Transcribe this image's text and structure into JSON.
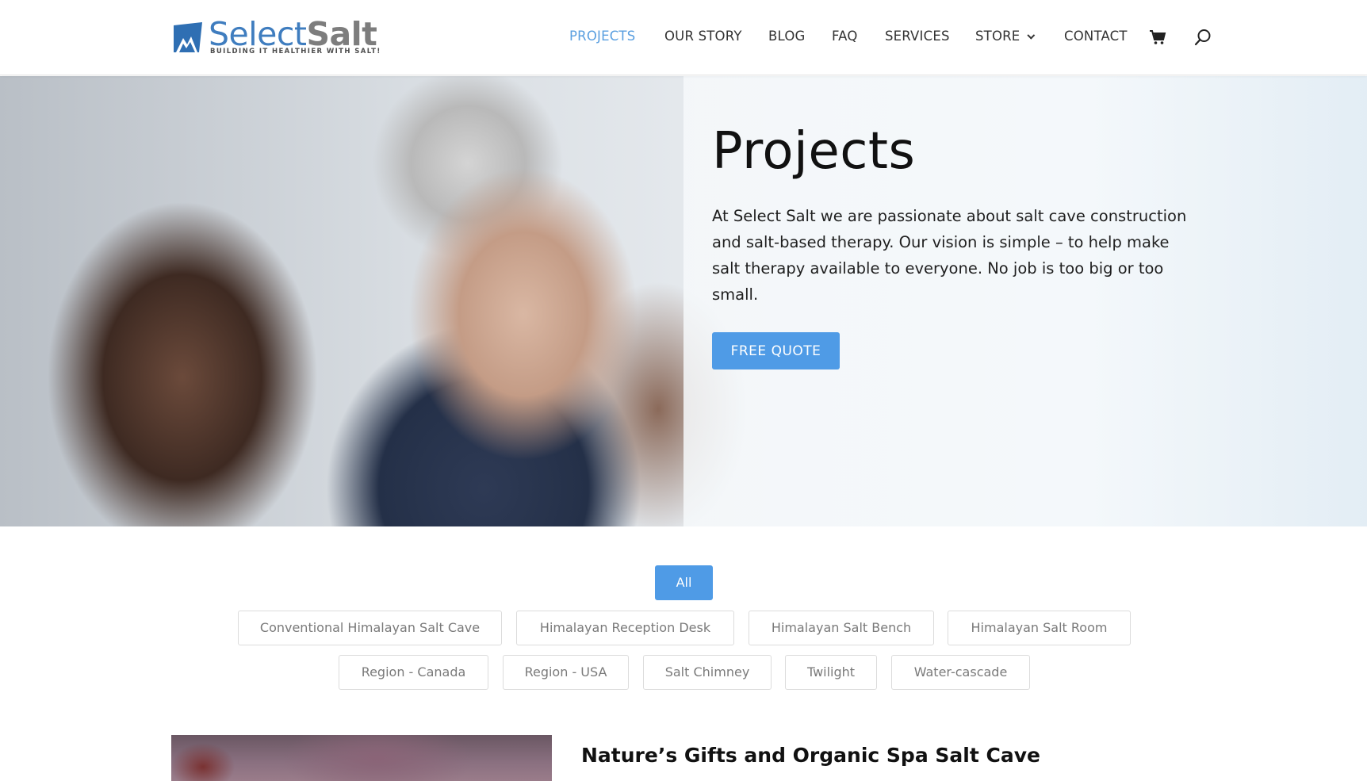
{
  "logo": {
    "word1": "Select",
    "word2": "Salt",
    "tagline": "BUILDING IT HEALTHIER WITH SALT!"
  },
  "nav": {
    "items": [
      {
        "label": "PROJECTS",
        "active": true
      },
      {
        "label": "OUR STORY"
      },
      {
        "label": "BLOG"
      },
      {
        "label": "FAQ"
      },
      {
        "label": "SERVICES"
      },
      {
        "label": "STORE",
        "has_dropdown": true
      },
      {
        "label": "CONTACT"
      }
    ],
    "icons": [
      "cart-icon",
      "search-icon"
    ]
  },
  "hero": {
    "title": "Projects",
    "text": "At Select Salt we are passionate about salt cave construction and salt-based therapy. Our vision is simple – to help make salt therapy available to everyone. No job is too big or too small.",
    "button": "FREE QUOTE"
  },
  "filters": {
    "all": "All",
    "row1": [
      "Conventional Himalayan Salt Cave",
      "Himalayan Reception Desk",
      "Himalayan Salt Bench",
      "Himalayan Salt Room"
    ],
    "row2": [
      "Region - Canada",
      "Region - USA",
      "Salt Chimney",
      "Twilight",
      "Water-cascade"
    ]
  },
  "project": {
    "title": "Nature’s Gifts and Organic Spa Salt Cave"
  },
  "colors": {
    "accent": "#4f9be6",
    "nav_active": "#5a9fe0",
    "logo_blue": "#3f7dbf",
    "logo_gray": "#7d7d7d"
  }
}
